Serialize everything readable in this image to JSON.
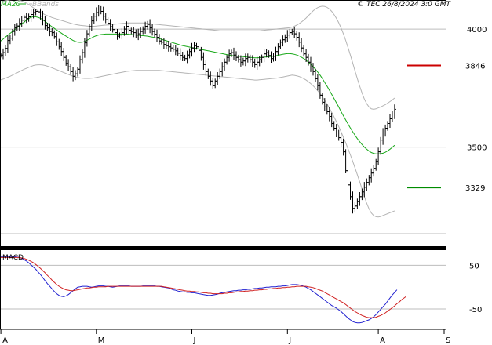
{
  "header": {
    "copyright": "© TEC 26/8/2024 3:0 GMT",
    "legend": [
      {
        "label": "MA20",
        "color": "#18a818"
      },
      {
        "label": "BBands",
        "color": "#b4b4b4"
      }
    ]
  },
  "chart_data": [
    {
      "type": "line",
      "subtype": "ohlc-bars-with-indicators",
      "title": "",
      "xlabel": "",
      "ylabel": "",
      "ylim": [
        3080,
        4120
      ],
      "y_ticks": [
        3500,
        4000
      ],
      "y_tick_labels": [
        "3500",
        "4000"
      ],
      "x_ticks": [
        "A",
        "M",
        "J",
        "J",
        "A",
        "S"
      ],
      "x_tick_index": [
        -3,
        41,
        82,
        123,
        162,
        220
      ],
      "grid": "horizontal",
      "levels": [
        {
          "label": "3846",
          "value": 3846,
          "color": "#cc0000"
        },
        {
          "label": "3329",
          "value": 3329,
          "color": "#008c00"
        }
      ],
      "series": [
        {
          "name": "Price",
          "values": [
            3890,
            3900,
            3918,
            3952,
            3962,
            3990,
            4005,
            4013,
            4025,
            4038,
            4050,
            4045,
            4052,
            4062,
            4070,
            4075,
            4073,
            4055,
            4038,
            4015,
            4005,
            3990,
            3985,
            3968,
            3946,
            3925,
            3905,
            3880,
            3855,
            3840,
            3820,
            3800,
            3810,
            3830,
            3870,
            3900,
            3942,
            3980,
            4010,
            4035,
            4055,
            4070,
            4085,
            4075,
            4055,
            4040,
            4025,
            4010,
            3998,
            3985,
            3970,
            3975,
            3985,
            4000,
            4012,
            3995,
            3990,
            3985,
            3975,
            3980,
            3990,
            4000,
            4012,
            4020,
            4005,
            3990,
            3978,
            3965,
            3950,
            3945,
            3935,
            3930,
            3925,
            3920,
            3915,
            3908,
            3898,
            3888,
            3880,
            3875,
            3890,
            3905,
            3920,
            3930,
            3925,
            3910,
            3880,
            3850,
            3820,
            3800,
            3780,
            3760,
            3780,
            3800,
            3820,
            3840,
            3860,
            3880,
            3895,
            3900,
            3890,
            3880,
            3870,
            3860,
            3865,
            3875,
            3880,
            3870,
            3860,
            3850,
            3860,
            3870,
            3880,
            3895,
            3900,
            3888,
            3875,
            3885,
            3905,
            3925,
            3945,
            3955,
            3965,
            3975,
            3985,
            3990,
            3980,
            3965,
            3945,
            3920,
            3895,
            3880,
            3860,
            3840,
            3820,
            3790,
            3760,
            3720,
            3690,
            3670,
            3650,
            3630,
            3600,
            3580,
            3560,
            3540,
            3520,
            3480,
            3400,
            3340,
            3290,
            3240,
            3250,
            3270,
            3290,
            3310,
            3330,
            3350,
            3370,
            3390,
            3410,
            3440,
            3480,
            3530,
            3560,
            3580,
            3600,
            3620,
            3640,
            3660
          ]
        },
        {
          "name": "MA20",
          "values": [
            3950,
            3958,
            3966,
            3974,
            3982,
            3990,
            3998,
            4006,
            4014,
            4022,
            4030,
            4038,
            4045,
            4050,
            4053,
            4052,
            4050,
            4046,
            4040,
            4033,
            4025,
            4017,
            4010,
            4003,
            3996,
            3989,
            3983,
            3976,
            3970,
            3964,
            3958,
            3952,
            3948,
            3945,
            3944,
            3945,
            3948,
            3953,
            3958,
            3963,
            3968,
            3972,
            3975,
            3977,
            3978,
            3979,
            3979,
            3979,
            3979,
            3979,
            3979,
            3979,
            3979,
            3979,
            3979,
            3978,
            3977,
            3976,
            3975,
            3974,
            3973,
            3972,
            3971,
            3970,
            3968,
            3966,
            3964,
            3962,
            3960,
            3957,
            3954,
            3951,
            3948,
            3945,
            3942,
            3939,
            3936,
            3933,
            3930,
            3928,
            3926,
            3924,
            3922,
            3920,
            3918,
            3916,
            3914,
            3912,
            3910,
            3908,
            3906,
            3904,
            3902,
            3900,
            3898,
            3896,
            3894,
            3892,
            3890,
            3888,
            3887,
            3886,
            3885,
            3884,
            3883,
            3882,
            3881,
            3880,
            3879,
            3878,
            3878,
            3879,
            3880,
            3881,
            3882,
            3883,
            3884,
            3885,
            3887,
            3889,
            3891,
            3893,
            3895,
            3896,
            3896,
            3895,
            3893,
            3890,
            3886,
            3881,
            3875,
            3868,
            3860,
            3851,
            3841,
            3830,
            3818,
            3805,
            3790,
            3774,
            3758,
            3741,
            3724,
            3706,
            3688,
            3670,
            3651,
            3633,
            3615,
            3598,
            3581,
            3565,
            3550,
            3536,
            3523,
            3511,
            3500,
            3491,
            3483,
            3477,
            3473,
            3471,
            3471,
            3472,
            3474,
            3478,
            3484,
            3491,
            3499,
            3508
          ]
        },
        {
          "name": "BBand-upper",
          "values": [
            4115,
            4118,
            4120,
            4122,
            4124,
            4125,
            4125,
            4124,
            4122,
            4119,
            4115,
            4110,
            4104,
            4097,
            4090,
            4083,
            4077,
            4071,
            4066,
            4061,
            4057,
            4053,
            4049,
            4046,
            4043,
            4040,
            4037,
            4034,
            4031,
            4028,
            4025,
            4022,
            4020,
            4018,
            4016,
            4015,
            4014,
            4013,
            4012,
            4012,
            4012,
            4013,
            4014,
            4015,
            4016,
            4017,
            4018,
            4019,
            4020,
            4021,
            4022,
            4023,
            4024,
            4025,
            4026,
            4026,
            4026,
            4026,
            4026,
            4026,
            4026,
            4026,
            4025,
            4024,
            4023,
            4022,
            4021,
            4020,
            4019,
            4018,
            4017,
            4016,
            4015,
            4014,
            4013,
            4012,
            4011,
            4010,
            4009,
            4008,
            4007,
            4006,
            4005,
            4004,
            4003,
            4002,
            4001,
            4000,
            3999,
            3998,
            3997,
            3996,
            3995,
            3994,
            3993,
            3993,
            3993,
            3993,
            3993,
            3993,
            3993,
            3993,
            3993,
            3993,
            3993,
            3993,
            3993,
            3993,
            3993,
            3993,
            3993,
            3993,
            3994,
            3995,
            3996,
            3997,
            3998,
            3999,
            4000,
            4001,
            4002,
            4003,
            4004,
            4005,
            4006,
            4008,
            4012,
            4017,
            4023,
            4030,
            4038,
            4047,
            4057,
            4067,
            4077,
            4085,
            4091,
            4095,
            4097,
            4096,
            4092,
            4085,
            4075,
            4062,
            4046,
            4027,
            4005,
            3980,
            3952,
            3922,
            3890,
            3857,
            3823,
            3790,
            3758,
            3729,
            3704,
            3684,
            3670,
            3662,
            3660,
            3662,
            3666,
            3670,
            3675,
            3680,
            3686,
            3693,
            3700,
            3708
          ]
        },
        {
          "name": "BBand-lower",
          "values": [
            3785,
            3788,
            3792,
            3796,
            3800,
            3805,
            3810,
            3815,
            3820,
            3825,
            3830,
            3834,
            3838,
            3842,
            3846,
            3848,
            3849,
            3849,
            3848,
            3846,
            3843,
            3840,
            3836,
            3832,
            3828,
            3824,
            3820,
            3816,
            3812,
            3808,
            3804,
            3800,
            3797,
            3795,
            3793,
            3792,
            3791,
            3791,
            3791,
            3792,
            3793,
            3795,
            3797,
            3799,
            3801,
            3803,
            3805,
            3807,
            3809,
            3811,
            3813,
            3815,
            3817,
            3819,
            3821,
            3822,
            3823,
            3824,
            3825,
            3825,
            3825,
            3825,
            3825,
            3825,
            3825,
            3825,
            3825,
            3825,
            3825,
            3824,
            3823,
            3822,
            3821,
            3820,
            3819,
            3818,
            3817,
            3816,
            3815,
            3814,
            3813,
            3812,
            3811,
            3810,
            3809,
            3808,
            3807,
            3806,
            3805,
            3804,
            3803,
            3802,
            3801,
            3800,
            3799,
            3798,
            3797,
            3796,
            3795,
            3794,
            3793,
            3792,
            3791,
            3790,
            3789,
            3788,
            3787,
            3786,
            3785,
            3784,
            3784,
            3785,
            3786,
            3787,
            3788,
            3789,
            3790,
            3791,
            3792,
            3793,
            3795,
            3797,
            3799,
            3801,
            3803,
            3805,
            3804,
            3802,
            3799,
            3795,
            3790,
            3784,
            3777,
            3769,
            3760,
            3750,
            3739,
            3727,
            3713,
            3698,
            3682,
            3665,
            3647,
            3628,
            3608,
            3587,
            3565,
            3542,
            3518,
            3493,
            3467,
            3440,
            3412,
            3383,
            3353,
            3322,
            3291,
            3262,
            3238,
            3221,
            3210,
            3205,
            3204,
            3206,
            3210,
            3214,
            3218,
            3222,
            3226,
            3230
          ]
        }
      ]
    },
    {
      "type": "line",
      "title": "MACD",
      "xlabel": "",
      "ylabel": "",
      "ylim": [
        -95,
        85
      ],
      "y_ticks": [
        50,
        -50
      ],
      "y_tick_labels": [
        "50",
        "-50"
      ],
      "grid": "horizontal",
      "series": [
        {
          "name": "MACD",
          "color": "#2020d0",
          "values": [
            70,
            70,
            70,
            70,
            70,
            70,
            70,
            69,
            68,
            66,
            63,
            60,
            56,
            51,
            46,
            41,
            35,
            29,
            22,
            15,
            8,
            2,
            -4,
            -10,
            -15,
            -19,
            -21,
            -22,
            -20,
            -17,
            -13,
            -8,
            -4,
            0,
            1,
            2,
            2,
            2,
            1,
            0,
            1,
            2,
            3,
            3,
            3,
            2,
            2,
            1,
            0,
            1,
            2,
            3,
            3,
            3,
            3,
            3,
            2,
            2,
            2,
            2,
            2,
            3,
            3,
            3,
            3,
            3,
            3,
            2,
            2,
            1,
            0,
            -1,
            -2,
            -4,
            -6,
            -7,
            -9,
            -10,
            -11,
            -11,
            -12,
            -12,
            -13,
            -13,
            -14,
            -15,
            -16,
            -17,
            -18,
            -19,
            -19,
            -18,
            -17,
            -16,
            -14,
            -13,
            -12,
            -11,
            -10,
            -9,
            -8,
            -8,
            -7,
            -7,
            -6,
            -6,
            -5,
            -5,
            -4,
            -3,
            -3,
            -2,
            -2,
            -1,
            0,
            0,
            1,
            1,
            1,
            2,
            2,
            3,
            3,
            4,
            5,
            6,
            6,
            6,
            5,
            4,
            2,
            0,
            -3,
            -6,
            -10,
            -14,
            -18,
            -22,
            -26,
            -30,
            -34,
            -38,
            -42,
            -45,
            -48,
            -52,
            -56,
            -61,
            -66,
            -71,
            -75,
            -79,
            -81,
            -82,
            -82,
            -81,
            -79,
            -77,
            -75,
            -72,
            -68,
            -63,
            -57,
            -51,
            -45,
            -39,
            -32,
            -25,
            -18,
            -12,
            -6
          ]
        },
        {
          "name": "Signal",
          "color": "#d02020",
          "values": [
            68,
            68,
            68,
            68,
            68,
            68,
            68,
            68,
            68,
            67,
            66,
            64,
            62,
            59,
            56,
            52,
            48,
            43,
            38,
            33,
            27,
            22,
            16,
            11,
            6,
            2,
            -1,
            -4,
            -6,
            -7,
            -8,
            -8,
            -7,
            -6,
            -5,
            -4,
            -3,
            -2,
            -2,
            -1,
            0,
            0,
            1,
            1,
            1,
            1,
            2,
            2,
            2,
            2,
            2,
            2,
            2,
            2,
            2,
            2,
            2,
            2,
            2,
            2,
            2,
            2,
            2,
            2,
            2,
            2,
            2,
            2,
            2,
            2,
            1,
            0,
            -1,
            -2,
            -3,
            -4,
            -5,
            -6,
            -7,
            -8,
            -9,
            -9,
            -10,
            -10,
            -11,
            -11,
            -12,
            -13,
            -13,
            -14,
            -14,
            -15,
            -15,
            -15,
            -15,
            -15,
            -14,
            -14,
            -13,
            -13,
            -12,
            -11,
            -11,
            -10,
            -10,
            -9,
            -9,
            -8,
            -8,
            -7,
            -7,
            -6,
            -6,
            -5,
            -5,
            -4,
            -4,
            -3,
            -3,
            -2,
            -2,
            -1,
            -1,
            0,
            0,
            1,
            1,
            2,
            2,
            2,
            2,
            2,
            1,
            0,
            -1,
            -3,
            -5,
            -7,
            -9,
            -12,
            -15,
            -18,
            -21,
            -24,
            -27,
            -30,
            -33,
            -36,
            -40,
            -44,
            -48,
            -52,
            -56,
            -59,
            -62,
            -65,
            -67,
            -69,
            -70,
            -70,
            -70,
            -69,
            -67,
            -65,
            -62,
            -59,
            -55,
            -51,
            -47,
            -43,
            -38,
            -34,
            -29,
            -25,
            -21
          ]
        }
      ]
    }
  ]
}
